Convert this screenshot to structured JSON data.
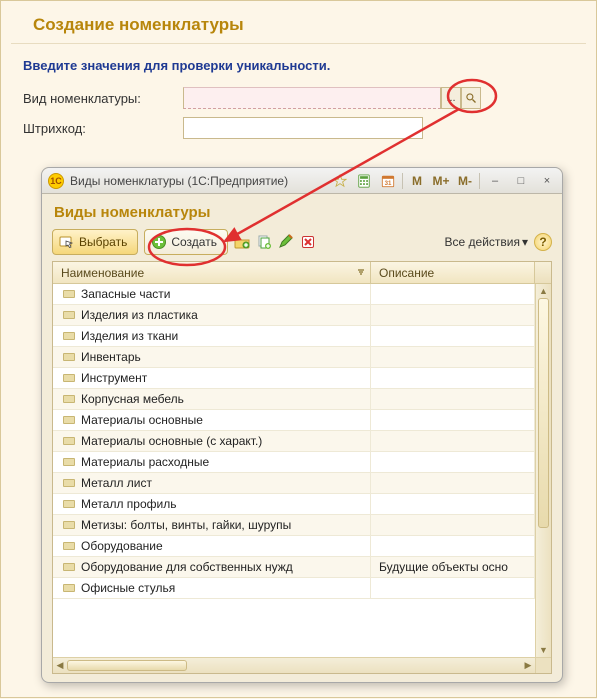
{
  "page": {
    "title": "Создание номенклатуры",
    "instruction": "Введите значения для проверки уникальности."
  },
  "form": {
    "nomenclature_type_label": "Вид номенклатуры:",
    "barcode_label": "Штрихкод:",
    "nomenclature_value": "",
    "barcode_value": "",
    "ellipsis": "..."
  },
  "popup": {
    "app_icon_text": "1C",
    "window_title": "Виды номенклатуры  (1С:Предприятие)",
    "titlebar_buttons": {
      "m": "M",
      "mplus": "M+",
      "mminus": "M-",
      "minimize": "–",
      "maximize": "□",
      "close": "×"
    },
    "heading": "Виды номенклатуры",
    "toolbar": {
      "select": "Выбрать",
      "create": "Создать",
      "all_actions": "Все действия",
      "dropdown_mark": "▾",
      "help": "?"
    },
    "grid": {
      "columns": {
        "name": "Наименование",
        "desc": "Описание"
      },
      "rows": [
        {
          "name": "Запасные части",
          "desc": ""
        },
        {
          "name": "Изделия из пластика",
          "desc": ""
        },
        {
          "name": "Изделия из ткани",
          "desc": ""
        },
        {
          "name": "Инвентарь",
          "desc": ""
        },
        {
          "name": "Инструмент",
          "desc": ""
        },
        {
          "name": "Корпусная мебель",
          "desc": ""
        },
        {
          "name": "Материалы основные",
          "desc": ""
        },
        {
          "name": "Материалы основные (с характ.)",
          "desc": ""
        },
        {
          "name": "Материалы расходные",
          "desc": ""
        },
        {
          "name": "Металл лист",
          "desc": ""
        },
        {
          "name": "Металл профиль",
          "desc": ""
        },
        {
          "name": "Метизы: болты, винты, гайки, шурупы",
          "desc": ""
        },
        {
          "name": "Оборудование",
          "desc": ""
        },
        {
          "name": "Оборудование для собственных нужд",
          "desc": "Будущие объекты осно"
        },
        {
          "name": "Офисные стулья",
          "desc": ""
        }
      ]
    }
  }
}
